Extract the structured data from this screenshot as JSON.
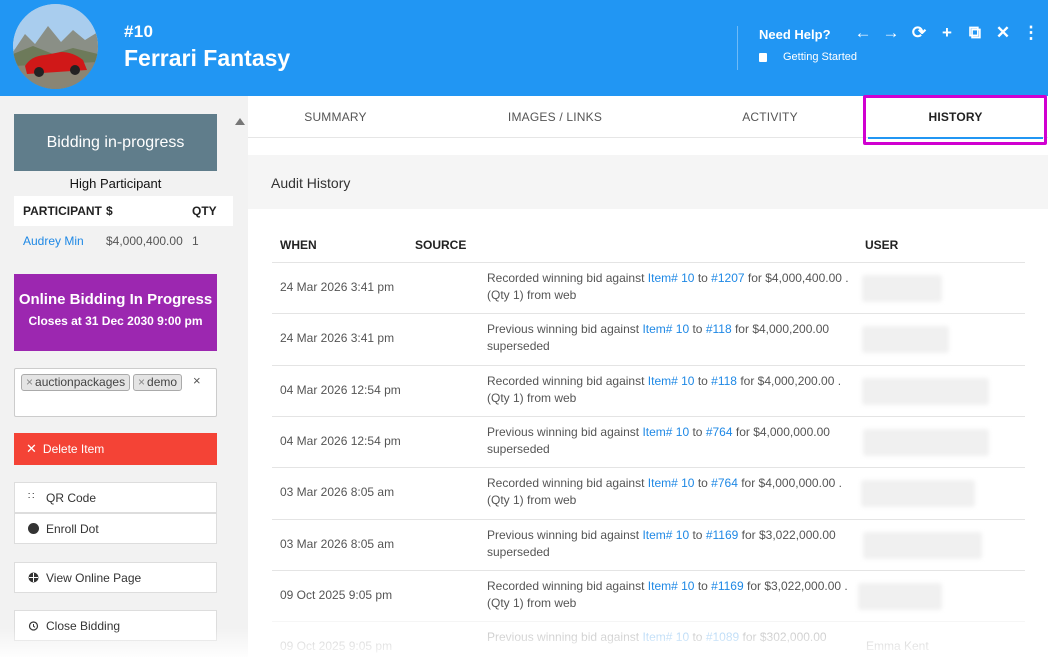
{
  "header": {
    "item_number": "#10",
    "item_title": "Ferrari Fantasy",
    "need_help": "Need Help?",
    "getting_started": "Getting Started",
    "icons": [
      "arrow-left-icon",
      "arrow-right-icon",
      "refresh-icon",
      "plus-icon",
      "copy-icon",
      "close-icon",
      "more-vertical-icon"
    ]
  },
  "sidebar": {
    "status": "Bidding in-progress",
    "high_participant": "High Participant",
    "participant_table": {
      "headers": [
        "PARTICIPANT",
        "$",
        "QTY"
      ],
      "rows": [
        {
          "name": "Audrey Min",
          "amount": "$4,000,400.00",
          "qty": "1"
        }
      ]
    },
    "online_bidding": "Online Bidding In Progress",
    "closes": "Closes at 31 Dec 2030 9:00 pm",
    "tags": [
      "auctionpackages",
      "demo"
    ],
    "tags_clear": "×",
    "delete_label": "Delete Item",
    "qr_label": "QR Code",
    "enroll_label": "Enroll Dot",
    "view_online_label": "View Online Page",
    "close_bidding_label": "Close Bidding"
  },
  "tabs": [
    "SUMMARY",
    "IMAGES / LINKS",
    "ACTIVITY",
    "HISTORY"
  ],
  "active_tab": "HISTORY",
  "audit": {
    "title": "Audit History",
    "headers": {
      "when": "WHEN",
      "source": "SOURCE",
      "user": "USER"
    },
    "rows": [
      {
        "when": "24 Mar 2026 3:41 pm",
        "pre": "Recorded winning bid against ",
        "item": "Item# 10",
        "mid": " to ",
        "bid": "#1207",
        "post": " for $4,000,400.00 .",
        "line2": "(Qty 1) from web"
      },
      {
        "when": "24 Mar 2026 3:41 pm",
        "pre": "Previous winning bid against ",
        "item": "Item# 10",
        "mid": " to ",
        "bid": "#118",
        "post": " for $4,000,200.00",
        "line2": "superseded"
      },
      {
        "when": "04 Mar 2026 12:54 pm",
        "pre": "Recorded winning bid against ",
        "item": "Item# 10",
        "mid": " to ",
        "bid": "#118",
        "post": " for $4,000,200.00 .",
        "line2": "(Qty 1) from web"
      },
      {
        "when": "04 Mar 2026 12:54 pm",
        "pre": "Previous winning bid against ",
        "item": "Item# 10",
        "mid": " to ",
        "bid": "#764",
        "post": " for $4,000,000.00",
        "line2": "superseded"
      },
      {
        "when": "03 Mar 2026 8:05 am",
        "pre": "Recorded winning bid against ",
        "item": "Item# 10",
        "mid": " to ",
        "bid": "#764",
        "post": " for $4,000,000.00 .",
        "line2": "(Qty 1) from web"
      },
      {
        "when": "03 Mar 2026 8:05 am",
        "pre": "Previous winning bid against ",
        "item": "Item# 10",
        "mid": " to ",
        "bid": "#1169",
        "post": " for $3,022,000.00",
        "line2": "superseded"
      },
      {
        "when": "09 Oct 2025 9:05 pm",
        "pre": "Recorded winning bid against ",
        "item": "Item# 10",
        "mid": " to ",
        "bid": "#1169",
        "post": " for $3,022,000.00 .",
        "line2": "(Qty 1) from web"
      },
      {
        "when": "09 Oct 2025 9:05 pm",
        "pre": "Previous winning bid against ",
        "item": "Item# 10",
        "mid": " to ",
        "bid": "#1089",
        "post": " for $302,000.00",
        "line2": "",
        "user": "Emma Kent"
      }
    ]
  },
  "colors": {
    "header": "#2196f3",
    "status": "#607d8b",
    "online": "#9c27b0",
    "delete": "#f44336",
    "link": "#1e88e5",
    "highlight": "#d000d0"
  }
}
